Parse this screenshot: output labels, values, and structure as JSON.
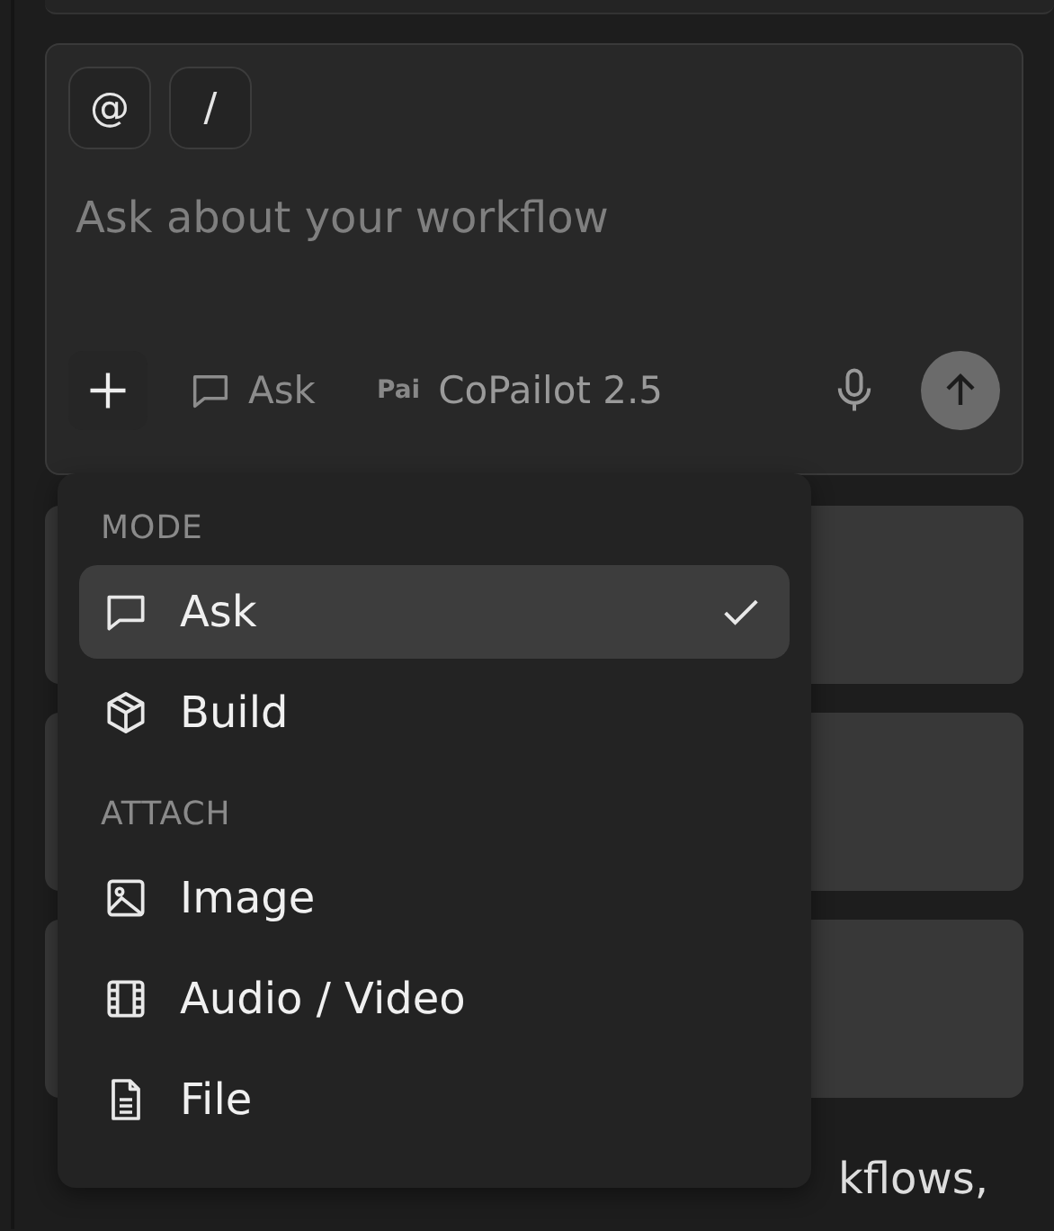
{
  "composer": {
    "chips": [
      "@",
      "/"
    ],
    "placeholder": "Ask about your workflow",
    "mode_button": "Ask",
    "model": {
      "logo": "Pai",
      "name": "CoPailot 2.5"
    }
  },
  "menu": {
    "sections": [
      {
        "title": "MODE",
        "items": [
          {
            "label": "Ask",
            "kind": "chat",
            "selected": true
          },
          {
            "label": "Build",
            "kind": "cube",
            "selected": false
          }
        ]
      },
      {
        "title": "ATTACH",
        "items": [
          {
            "label": "Image",
            "kind": "image"
          },
          {
            "label": "Audio / Video",
            "kind": "film"
          },
          {
            "label": "File",
            "kind": "file"
          }
        ]
      }
    ]
  },
  "tip_fragment": "kflows,"
}
